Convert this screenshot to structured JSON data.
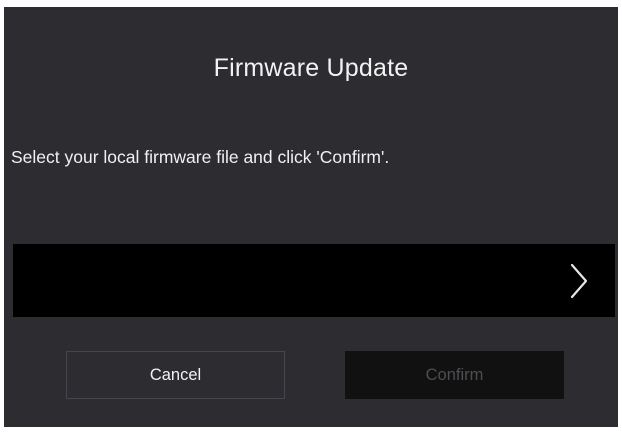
{
  "dialog": {
    "title": "Firmware Update",
    "instruction": "Select your local firmware file and click 'Confirm'.",
    "file_picker": {
      "value": "",
      "icon": "chevron-right-icon"
    },
    "buttons": {
      "cancel_label": "Cancel",
      "confirm_label": "Confirm",
      "confirm_disabled": true
    }
  },
  "colors": {
    "dialog_background": "#2c2c31",
    "file_picker_background": "#000000",
    "confirm_disabled_background": "#111112",
    "text_primary": "#f2f2f2",
    "text_disabled": "#4d4d52"
  }
}
